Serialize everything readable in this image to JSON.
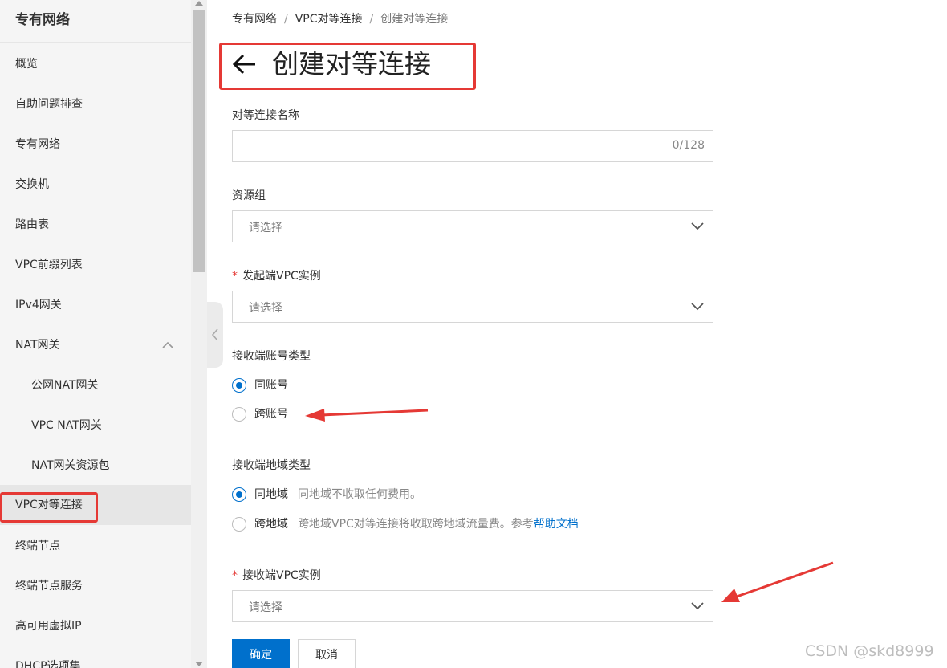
{
  "sidebar": {
    "title": "专有网络",
    "items": [
      {
        "label": "概览"
      },
      {
        "label": "自助问题排查"
      },
      {
        "label": "专有网络"
      },
      {
        "label": "交换机"
      },
      {
        "label": "路由表"
      },
      {
        "label": "VPC前缀列表"
      },
      {
        "label": "IPv4网关"
      },
      {
        "label": "NAT网关"
      },
      {
        "label": "公网NAT网关"
      },
      {
        "label": "VPC NAT网关"
      },
      {
        "label": "NAT网关资源包"
      },
      {
        "label": "VPC对等连接"
      },
      {
        "label": "终端节点"
      },
      {
        "label": "终端节点服务"
      },
      {
        "label": "高可用虚拟IP"
      },
      {
        "label": "DHCP选项集"
      }
    ],
    "active_item": "VPC对等连接"
  },
  "breadcrumb": {
    "items": [
      "专有网络",
      "VPC对等连接",
      "创建对等连接"
    ],
    "separator": "/"
  },
  "page": {
    "title": "创建对等连接",
    "back_icon": "arrow-left-icon"
  },
  "form": {
    "name": {
      "label": "对等连接名称",
      "value": "",
      "counter": "0/128"
    },
    "resource_group": {
      "label": "资源组",
      "placeholder": "请选择"
    },
    "initiator_vpc": {
      "required_mark": "*",
      "label": "发起端VPC实例",
      "placeholder": "请选择"
    },
    "account_type": {
      "label": "接收端账号类型",
      "options": [
        {
          "label": "同账号",
          "checked": true
        },
        {
          "label": "跨账号",
          "checked": false
        }
      ]
    },
    "region_type": {
      "label": "接收端地域类型",
      "options": [
        {
          "label": "同地域",
          "desc": "同地域不收取任何费用。",
          "checked": true
        },
        {
          "label": "跨地域",
          "desc": "跨地域VPC对等连接将收取跨地域流量费。参考",
          "link": "帮助文档",
          "checked": false
        }
      ]
    },
    "acceptor_vpc": {
      "required_mark": "*",
      "label": "接收端VPC实例",
      "placeholder": "请选择"
    }
  },
  "buttons": {
    "confirm": "确定",
    "cancel": "取消"
  },
  "watermark": "CSDN @skd8999",
  "colors": {
    "primary": "#0070cc",
    "annotation_red": "#e53935",
    "sidebar_bg": "#f5f5f5"
  }
}
